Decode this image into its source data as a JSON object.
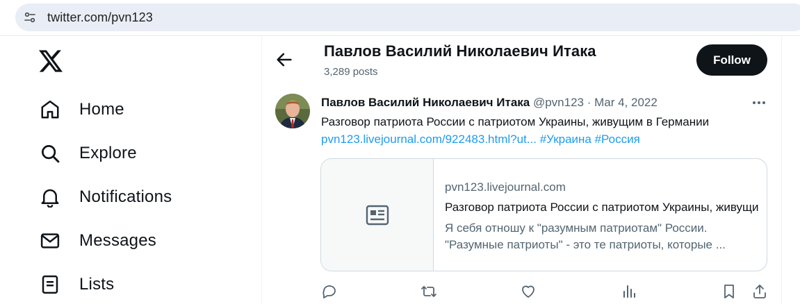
{
  "browser": {
    "url": "twitter.com/pvn123",
    "site_info_icon": "tune-icon"
  },
  "nav": {
    "logo_icon": "x-logo-icon",
    "items": [
      {
        "label": "Home",
        "icon": "home-icon"
      },
      {
        "label": "Explore",
        "icon": "search-icon"
      },
      {
        "label": "Notifications",
        "icon": "bell-icon"
      },
      {
        "label": "Messages",
        "icon": "envelope-icon"
      },
      {
        "label": "Lists",
        "icon": "list-icon"
      }
    ]
  },
  "header": {
    "name": "Павлов Василий Николаевич Итака",
    "posts": "3,289 posts",
    "follow_label": "Follow"
  },
  "tweet": {
    "author": "Павлов Василий Николаевич Итака",
    "meta": "@pvn123 · Mar 4, 2022",
    "text": "Разговор патриота России с патриотом Украины, живущим в Германии",
    "link": "pvn123.livejournal.com/922483.html?ut...",
    "hashtags": "#Украина #Россия",
    "card": {
      "domain": "pvn123.livejournal.com",
      "title": "Разговор патриота России с патриотом Украины, живущим в Германии",
      "desc_line1": "Я себя отношу к \"разумным патриотам\" России.",
      "desc_line2": "\"Разумные патриоты\" - это те патриоты, которые ..."
    },
    "actions": [
      "reply-icon",
      "retweet-icon",
      "like-icon",
      "views-icon",
      "bookmark-icon",
      "share-icon"
    ]
  },
  "colors": {
    "accent": "#1d9bf0",
    "text": "#0f1419",
    "muted": "#536471",
    "follow_bg": "#0f1419"
  }
}
